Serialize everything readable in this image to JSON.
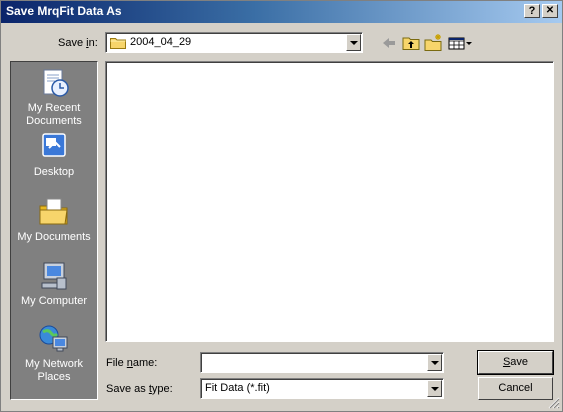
{
  "window": {
    "title": "Save MrqFit Data As",
    "help_label": "?",
    "close_label": "✕"
  },
  "save_in": {
    "label_pre": "Save ",
    "label_accel": "i",
    "label_post": "n:",
    "value": "2004_04_29"
  },
  "toolbar": {
    "back_icon": "back-arrow-icon",
    "up_icon": "up-folder-icon",
    "new_folder_icon": "new-folder-icon",
    "view_icon": "view-menu-icon"
  },
  "places": [
    {
      "line1": "My Recent",
      "line2": "Documents",
      "icon": "recent-documents-icon"
    },
    {
      "line1": "Desktop",
      "line2": "",
      "icon": "desktop-icon"
    },
    {
      "line1": "My Documents",
      "line2": "",
      "icon": "my-documents-icon"
    },
    {
      "line1": "My Computer",
      "line2": "",
      "icon": "my-computer-icon"
    },
    {
      "line1": "My Network",
      "line2": "Places",
      "icon": "network-places-icon"
    }
  ],
  "file_name": {
    "label_pre": "File ",
    "label_accel": "n",
    "label_post": "ame:",
    "value": ""
  },
  "save_type": {
    "label_pre": "Save as ",
    "label_accel": "t",
    "label_post": "ype:",
    "value": "Fit Data (*.fit)"
  },
  "buttons": {
    "save_accel": "S",
    "save_rest": "ave",
    "cancel": "Cancel"
  },
  "colors": {
    "titlebar_start": "#0a246a",
    "titlebar_end": "#a6caf0",
    "face": "#d4d0c8",
    "places_bg": "#808080"
  }
}
